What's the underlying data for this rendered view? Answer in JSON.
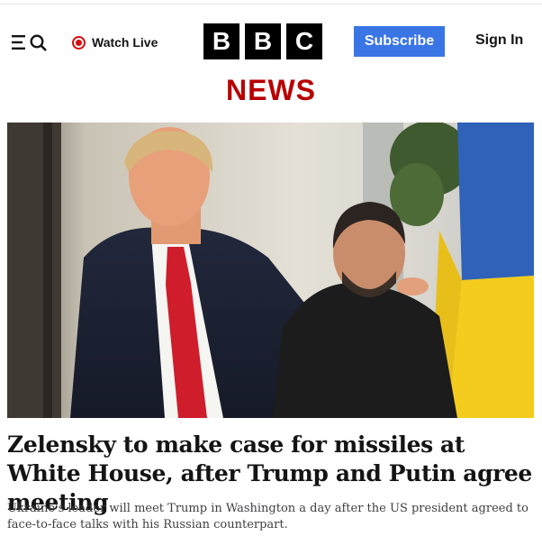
{
  "header": {
    "menu_icon": "menu-icon",
    "search_icon": "search-icon",
    "watch_live_label": "Watch Live",
    "live_icon": "live-record-icon",
    "logo_letters": [
      "B",
      "B",
      "C"
    ],
    "subscribe_label": "Subscribe",
    "signin_label": "Sign In"
  },
  "section": {
    "title": "NEWS"
  },
  "article": {
    "image_description_icon": "lead-photo",
    "headline": "Zelensky to make case for missiles at White House, after Trump and Putin agree meeting",
    "summary": "Ukraine's leader will meet Trump in Washington a day after the US president agreed to face-to-face talks with his Russian counterpart."
  },
  "colors": {
    "brand_red": "#b80000",
    "live_red": "#d70b0b",
    "subscribe_blue": "#3a75e6",
    "logo_black": "#000000"
  }
}
